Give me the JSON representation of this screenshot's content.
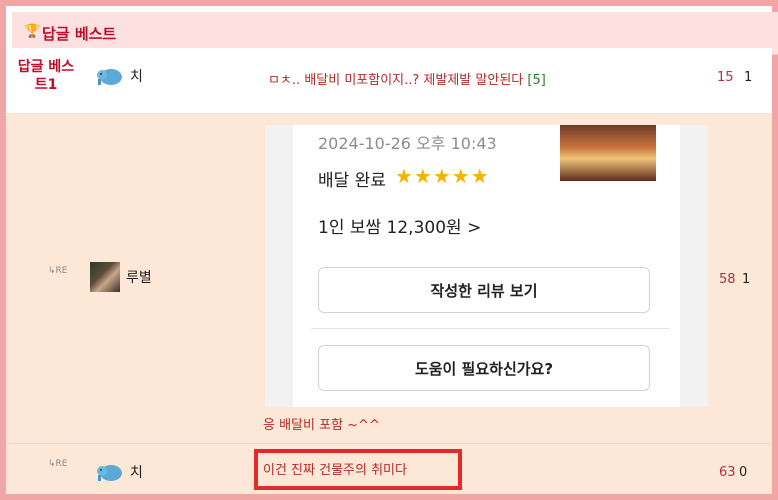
{
  "header": {
    "trophy_icon": "trophy-icon",
    "title": "답글 베스트"
  },
  "rows": [
    {
      "best_label": "답글 베스트1",
      "author": "치",
      "avatar_icon": "elephant-avatar-icon",
      "comment": "ㅁㅊ.. 배달비 미포함이지..? 제발제발 말안된다",
      "reply_count": "[5]",
      "likes": "15",
      "dislikes": "1"
    },
    {
      "reply_marker": "↳RE",
      "author": "루별",
      "avatar_icon": "profile-photo",
      "image": {
        "date": "2024-10-26 오후 10:43",
        "status": "배달 완료",
        "stars": "★★★★★",
        "order": "1인 보쌈 12,300원 >",
        "button1": "작성한 리뷰 보기",
        "button2": "도움이 필요하신가요?"
      },
      "comment": "응 배달비 포함 ~^^",
      "likes": "58",
      "dislikes": "1"
    },
    {
      "reply_marker": "↳RE",
      "author": "치",
      "avatar_icon": "elephant-avatar-icon",
      "comment": "이건 진짜 건물주의 취미다",
      "likes": "63",
      "dislikes": "0"
    }
  ],
  "colors": {
    "frame_border": "#f2a5a5",
    "header_bg": "#fde1e1",
    "reply_bg": "#fde7d6",
    "accent_red": "#b80f2a",
    "highlight_box": "#e12b2b"
  }
}
